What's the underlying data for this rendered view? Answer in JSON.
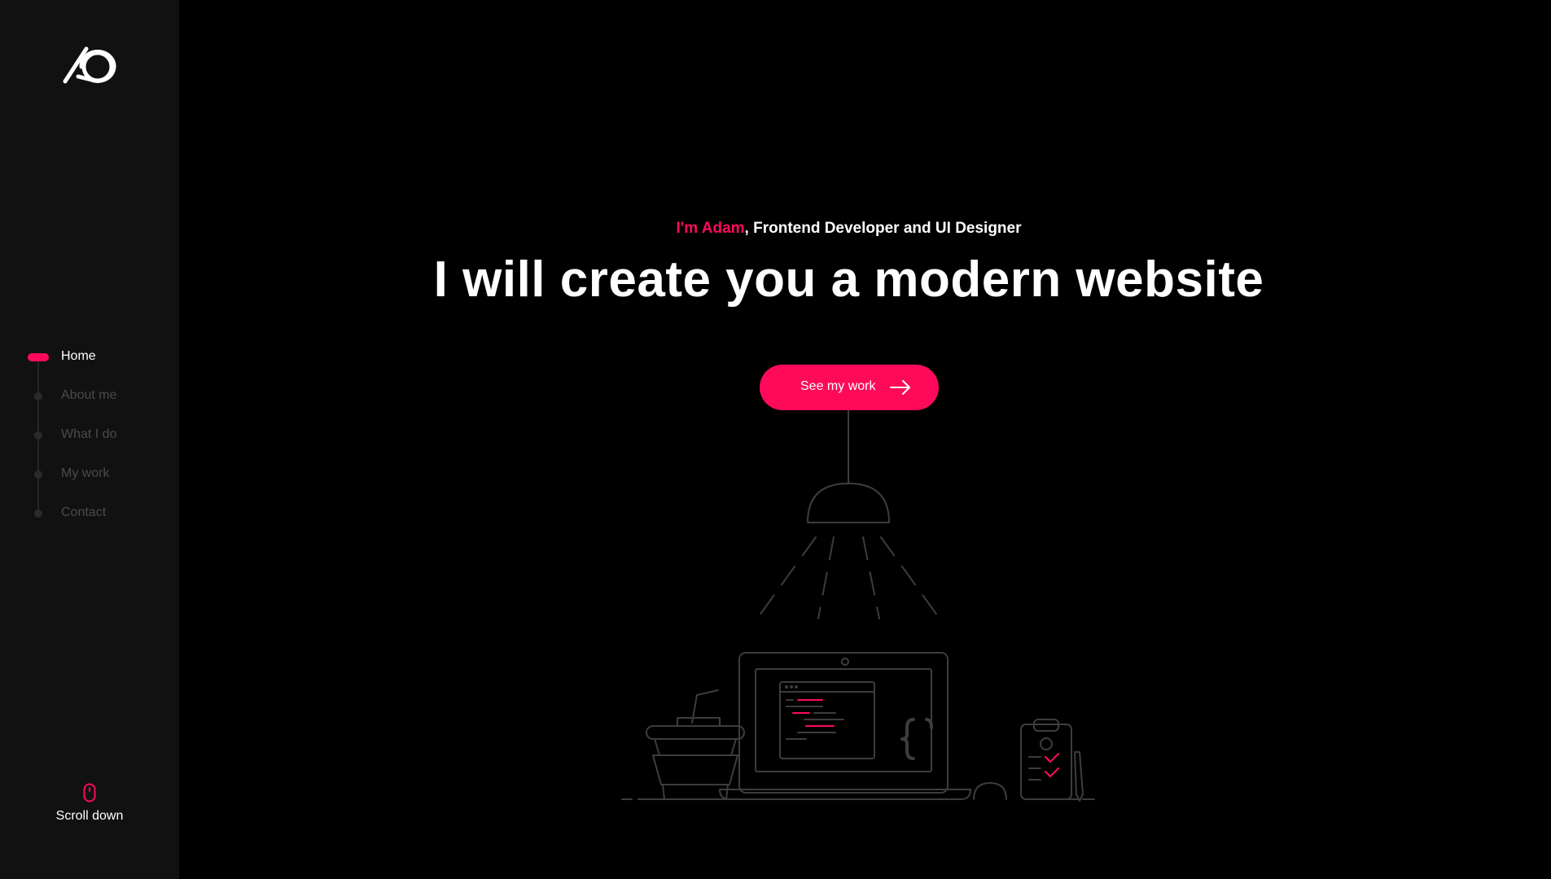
{
  "brand": {
    "logo_icon": "ao-monogram-logo"
  },
  "nav": {
    "items": [
      {
        "label": "Home",
        "active": true
      },
      {
        "label": "About me",
        "active": false
      },
      {
        "label": "What I do",
        "active": false
      },
      {
        "label": "My work",
        "active": false
      },
      {
        "label": "Contact",
        "active": false
      }
    ]
  },
  "scroll": {
    "icon": "mouse-icon",
    "label": "Scroll down"
  },
  "hero": {
    "intro_name": "I'm Adam",
    "intro_role": ", Frontend Developer and UI Designer",
    "headline": "I will create you a modern website",
    "cta_label": "See my work",
    "cta_icon": "arrow-right-icon"
  },
  "colors": {
    "accent": "#ff0a5a",
    "background": "#000000",
    "sidebar": "#111111",
    "muted_text": "#4a4a4a",
    "line_art": "#3d3d3d"
  }
}
